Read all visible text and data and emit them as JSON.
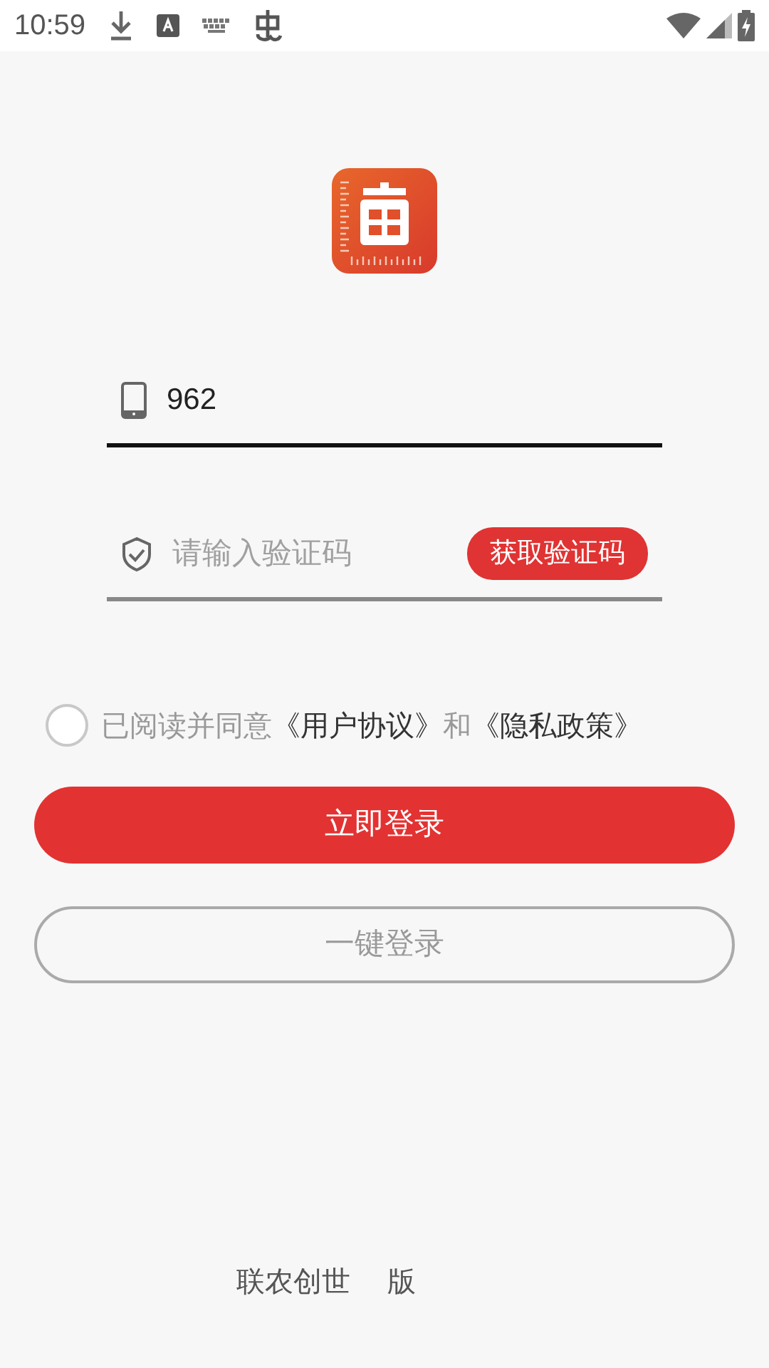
{
  "status_bar": {
    "time": "10:59"
  },
  "phone_field": {
    "value": "962"
  },
  "code_field": {
    "placeholder": "请输入验证码"
  },
  "get_code_button": "获取验证码",
  "agreement": {
    "checked": false,
    "parts": [
      {
        "text": "已阅读并同意",
        "kind": "plain"
      },
      {
        "text": "《用户协议》",
        "kind": "link"
      },
      {
        "text": "和",
        "kind": "plain"
      },
      {
        "text": "《隐私政策》",
        "kind": "link"
      }
    ]
  },
  "login_button": "立即登录",
  "one_click_button": "一键登录",
  "footer": [
    "联农创世",
    "版"
  ]
}
